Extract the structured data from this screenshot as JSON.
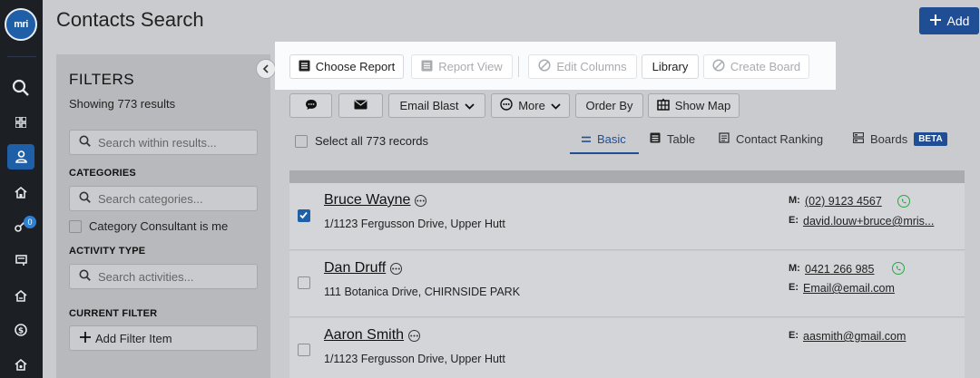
{
  "app": {
    "logo_text": "mri"
  },
  "nav": {
    "icons": [
      "search-icon",
      "dashboard-icon",
      "contacts-icon",
      "home-icon",
      "key-icon",
      "list-icon",
      "property-icon",
      "dollar-icon",
      "offers-icon"
    ],
    "key_badge": "0"
  },
  "header": {
    "title": "Contacts Search",
    "add_label": "Add"
  },
  "filters": {
    "title": "FILTERS",
    "results_text": "Showing 773 results",
    "search_placeholder": "Search within results...",
    "categories_label": "CATEGORIES",
    "categories_placeholder": "Search categories...",
    "consultant_checkbox": "Category Consultant is me",
    "activity_label": "ACTIVITY TYPE",
    "activity_placeholder": "Search activities...",
    "current_filter_label": "CURRENT FILTER",
    "add_filter_label": "Add Filter Item"
  },
  "report_toolbar": {
    "choose_report": "Choose Report",
    "report_view": "Report View",
    "edit_columns": "Edit Columns",
    "library": "Library",
    "create_board": "Create Board"
  },
  "actions": {
    "email_blast": "Email Blast",
    "more": "More",
    "order_by": "Order By",
    "show_map": "Show Map"
  },
  "select_all_label": "Select all 773 records",
  "view_tabs": [
    {
      "label": "Basic",
      "active": true
    },
    {
      "label": "Table"
    },
    {
      "label": "Contact Ranking"
    },
    {
      "label": "Boards",
      "badge": "BETA"
    }
  ],
  "contacts": [
    {
      "name": "Bruce Wayne",
      "address": "1/1123 Fergusson Drive, Upper Hutt",
      "checked": true,
      "mobile_label": "M:",
      "mobile": "(02) 9123 4567",
      "email_label": "E:",
      "email": "david.louw+bruce@mris..."
    },
    {
      "name": "Dan Druff",
      "address": "111 Botanica Drive, CHIRNSIDE PARK",
      "checked": false,
      "mobile_label": "M:",
      "mobile": "0421 266 985",
      "email_label": "E:",
      "email": "Email@email.com"
    },
    {
      "name": "Aaron Smith",
      "address": "1/1123 Fergusson Drive, Upper Hutt",
      "checked": false,
      "email_label": "E:",
      "email": "aasmith@gmail.com"
    }
  ],
  "colors": {
    "brand": "#1f4e94",
    "rail": "#1c1f24",
    "whatsapp": "#2aa64a"
  }
}
